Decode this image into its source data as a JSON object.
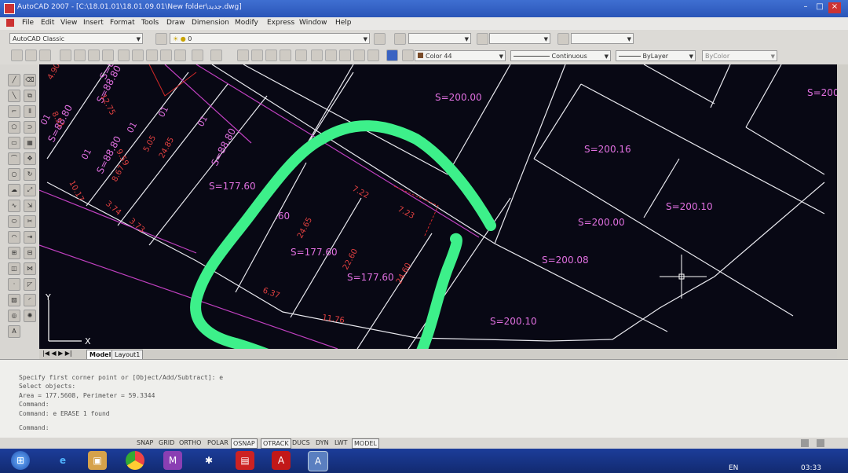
{
  "window": {
    "title": "AutoCAD 2007 - [C:\\18.01.01\\18.01.09.01\\New folder\\جديد.dwg]"
  },
  "menu": [
    "File",
    "Edit",
    "View",
    "Insert",
    "Format",
    "Tools",
    "Draw",
    "Dimension",
    "Modify",
    "Express",
    "Window",
    "Help"
  ],
  "toolbar": {
    "workspace": "AutoCAD Classic",
    "layer": "0",
    "color": "Color 44",
    "linetype": "Continuous",
    "lineweight": "ByLayer",
    "plotstyle": "ByColor"
  },
  "drawing": {
    "areas": [
      "S=200.00",
      "S=200.16",
      "S=200.10",
      "S=200.00",
      "S=200.08",
      "S=200.10",
      "S=177.60",
      "S=177.60",
      "S=177.60",
      "S=88.80",
      "S=88.80",
      "S=88.80",
      "S=88.80",
      "S=88.80",
      "S=200.",
      ".60"
    ],
    "dims": [
      "7.22",
      "7.23",
      "24.65",
      "22.60",
      "24.60",
      "6.37",
      "11.76",
      "10.17",
      "3.74",
      "3.73",
      "8.67",
      "9.59",
      "5.05",
      "24.85",
      "12.75",
      "8.51",
      "4.90"
    ],
    "lot_labels": [
      "01",
      "01",
      "01",
      "01",
      "01"
    ],
    "axis": {
      "y": "Y",
      "x": "X"
    }
  },
  "tabs": {
    "model": "Model",
    "layout": "Layout1"
  },
  "command_lines": [
    "Specify first corner point or [Object/Add/Subtract]: e",
    "Select objects:",
    "Area = 177.5608, Perimeter = 59.3344",
    "Command:",
    "Command: e ERASE 1 found",
    "",
    "Command:"
  ],
  "status_buttons": [
    "SNAP",
    "GRID",
    "ORTHO",
    "POLAR",
    "OSNAP",
    "OTRACK",
    "DUCS",
    "DYN",
    "LWT",
    "MODEL"
  ],
  "taskbar": {
    "lang": "EN",
    "time": "03:33"
  },
  "colors": {
    "canvas": "#080814",
    "annotation_marker": "#3df08a",
    "area_text": "#e070e0",
    "dim_text": "#e04040"
  }
}
